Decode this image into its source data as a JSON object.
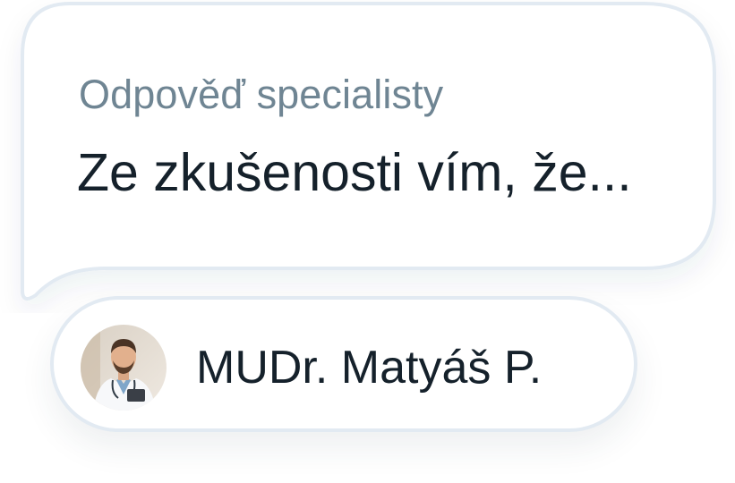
{
  "card": {
    "label": "Odpověď specialisty",
    "text": "Ze zkušenosti vím, že..."
  },
  "author": {
    "name": "MUDr. Matyáš P.",
    "avatar_icon": "doctor-avatar"
  },
  "colors": {
    "bubble_border": "#e2eaf2",
    "label": "#6f8593",
    "text": "#15212b"
  }
}
